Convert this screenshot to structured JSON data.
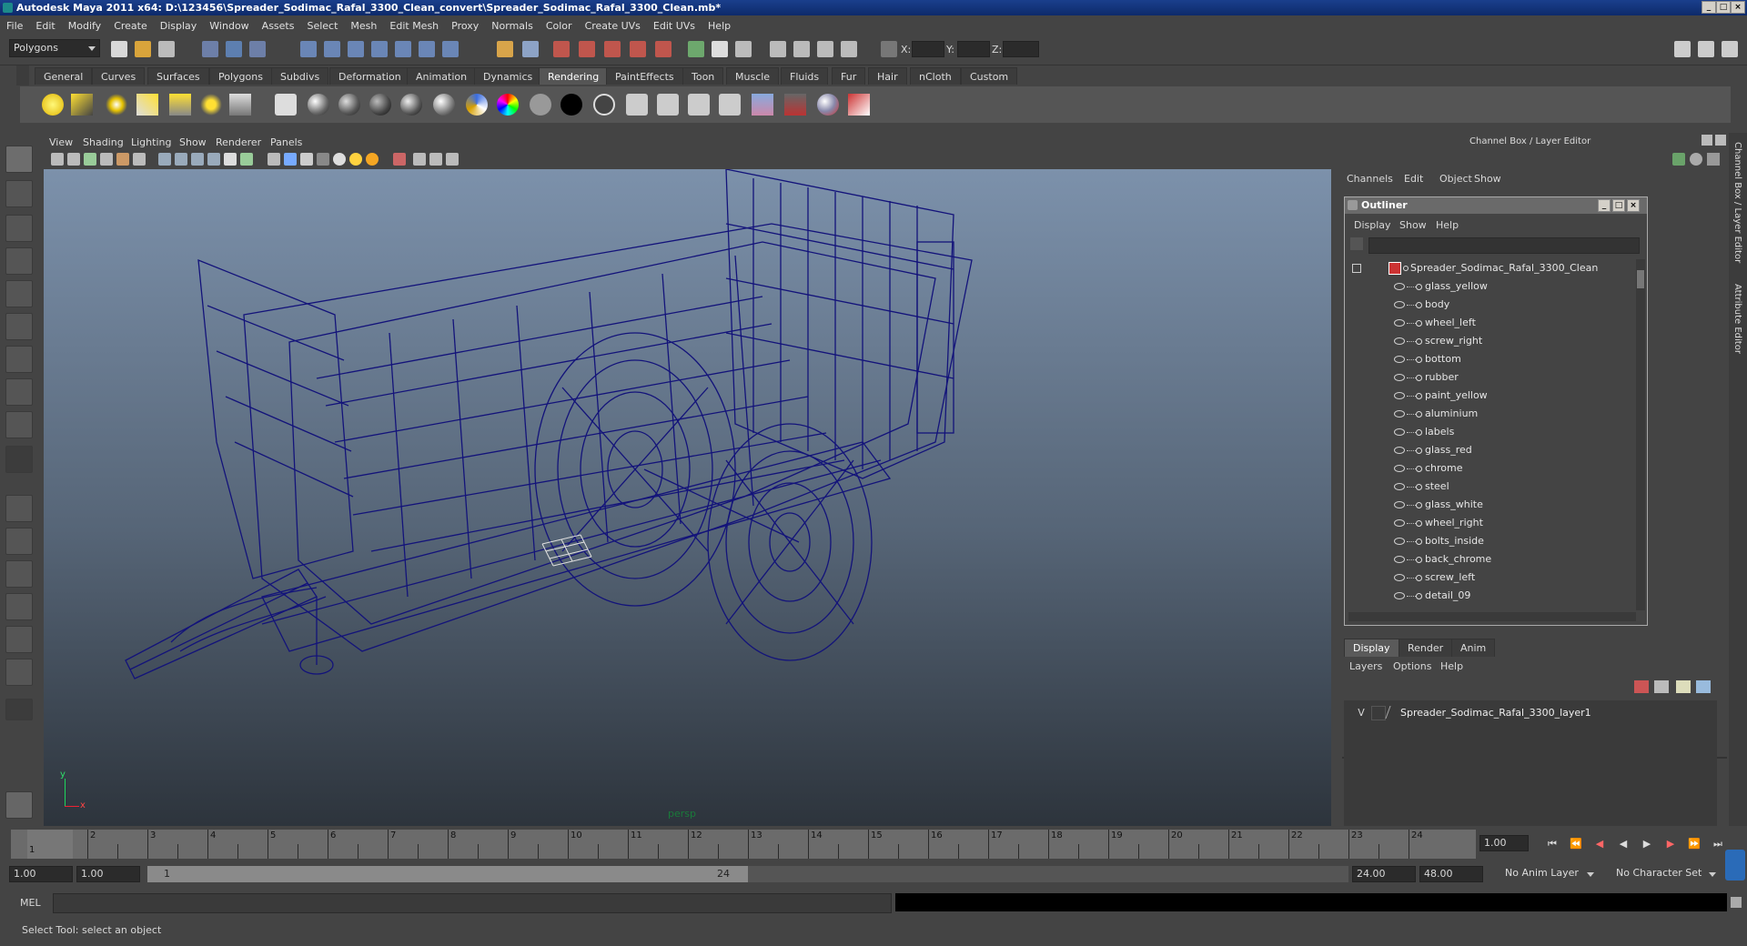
{
  "title": "Autodesk Maya 2011 x64: D:\\123456\\Spreader_Sodimac_Rafal_3300_Clean_convert\\Spreader_Sodimac_Rafal_3300_Clean.mb*",
  "menu": [
    "File",
    "Edit",
    "Modify",
    "Create",
    "Display",
    "Window",
    "Assets",
    "Select",
    "Mesh",
    "Edit Mesh",
    "Proxy",
    "Normals",
    "Color",
    "Create UVs",
    "Edit UVs",
    "Help"
  ],
  "statusline": {
    "mode": "Polygons",
    "x_label": "X:",
    "y_label": "Y:",
    "z_label": "Z:"
  },
  "shelf_tabs": [
    "General",
    "Curves",
    "Surfaces",
    "Polygons",
    "Subdivs",
    "Deformation",
    "Animation",
    "Dynamics",
    "Rendering",
    "PaintEffects",
    "Toon",
    "Muscle",
    "Fluids",
    "Fur",
    "Hair",
    "nCloth",
    "Custom"
  ],
  "active_shelf_tab": "Rendering",
  "viewport": {
    "menu": [
      "View",
      "Shading",
      "Lighting",
      "Show",
      "Renderer",
      "Panels"
    ],
    "camera_label": "persp",
    "axis_x": "x",
    "axis_y": "y",
    "wire_color": "#13137a"
  },
  "channel_box": {
    "title": "Channel Box / Layer Editor",
    "menu": [
      "Channels",
      "Edit",
      "Object",
      "Show"
    ]
  },
  "side_tabs": [
    "Channel Box / Layer Editor",
    "Attribute Editor"
  ],
  "outliner": {
    "title": "Outliner",
    "menu": [
      "Display",
      "Show",
      "Help"
    ],
    "root": "Spreader_Sodimac_Rafal_3300_Clean",
    "items": [
      "glass_yellow",
      "body",
      "wheel_left",
      "screw_right",
      "bottom",
      "rubber",
      "paint_yellow",
      "aluminium",
      "labels",
      "glass_red",
      "chrome",
      "steel",
      "glass_white",
      "wheel_right",
      "bolts_inside",
      "back_chrome",
      "screw_left",
      "detail_09"
    ]
  },
  "layer_editor": {
    "tabs": [
      "Display",
      "Render",
      "Anim"
    ],
    "active_tab": "Display",
    "menu": [
      "Layers",
      "Options",
      "Help"
    ],
    "layers": [
      {
        "visible": "V",
        "name": "Spreader_Sodimac_Rafal_3300_layer1"
      }
    ]
  },
  "timeline": {
    "ticks": [
      "1",
      "2",
      "3",
      "4",
      "5",
      "6",
      "7",
      "8",
      "9",
      "10",
      "11",
      "12",
      "13",
      "14",
      "15",
      "16",
      "17",
      "18",
      "19",
      "20",
      "21",
      "22",
      "23",
      "24"
    ],
    "current_frame_marker": "1",
    "current_time": "1.00"
  },
  "range": {
    "start_time": "1.00",
    "playback_start": "1.00",
    "range_start": "1",
    "range_end": "24",
    "playback_end": "24.00",
    "end_time": "48.00",
    "anim_layer": "No Anim Layer",
    "character_set": "No Character Set"
  },
  "command": {
    "label": "MEL"
  },
  "help_line": "Select Tool: select an object"
}
